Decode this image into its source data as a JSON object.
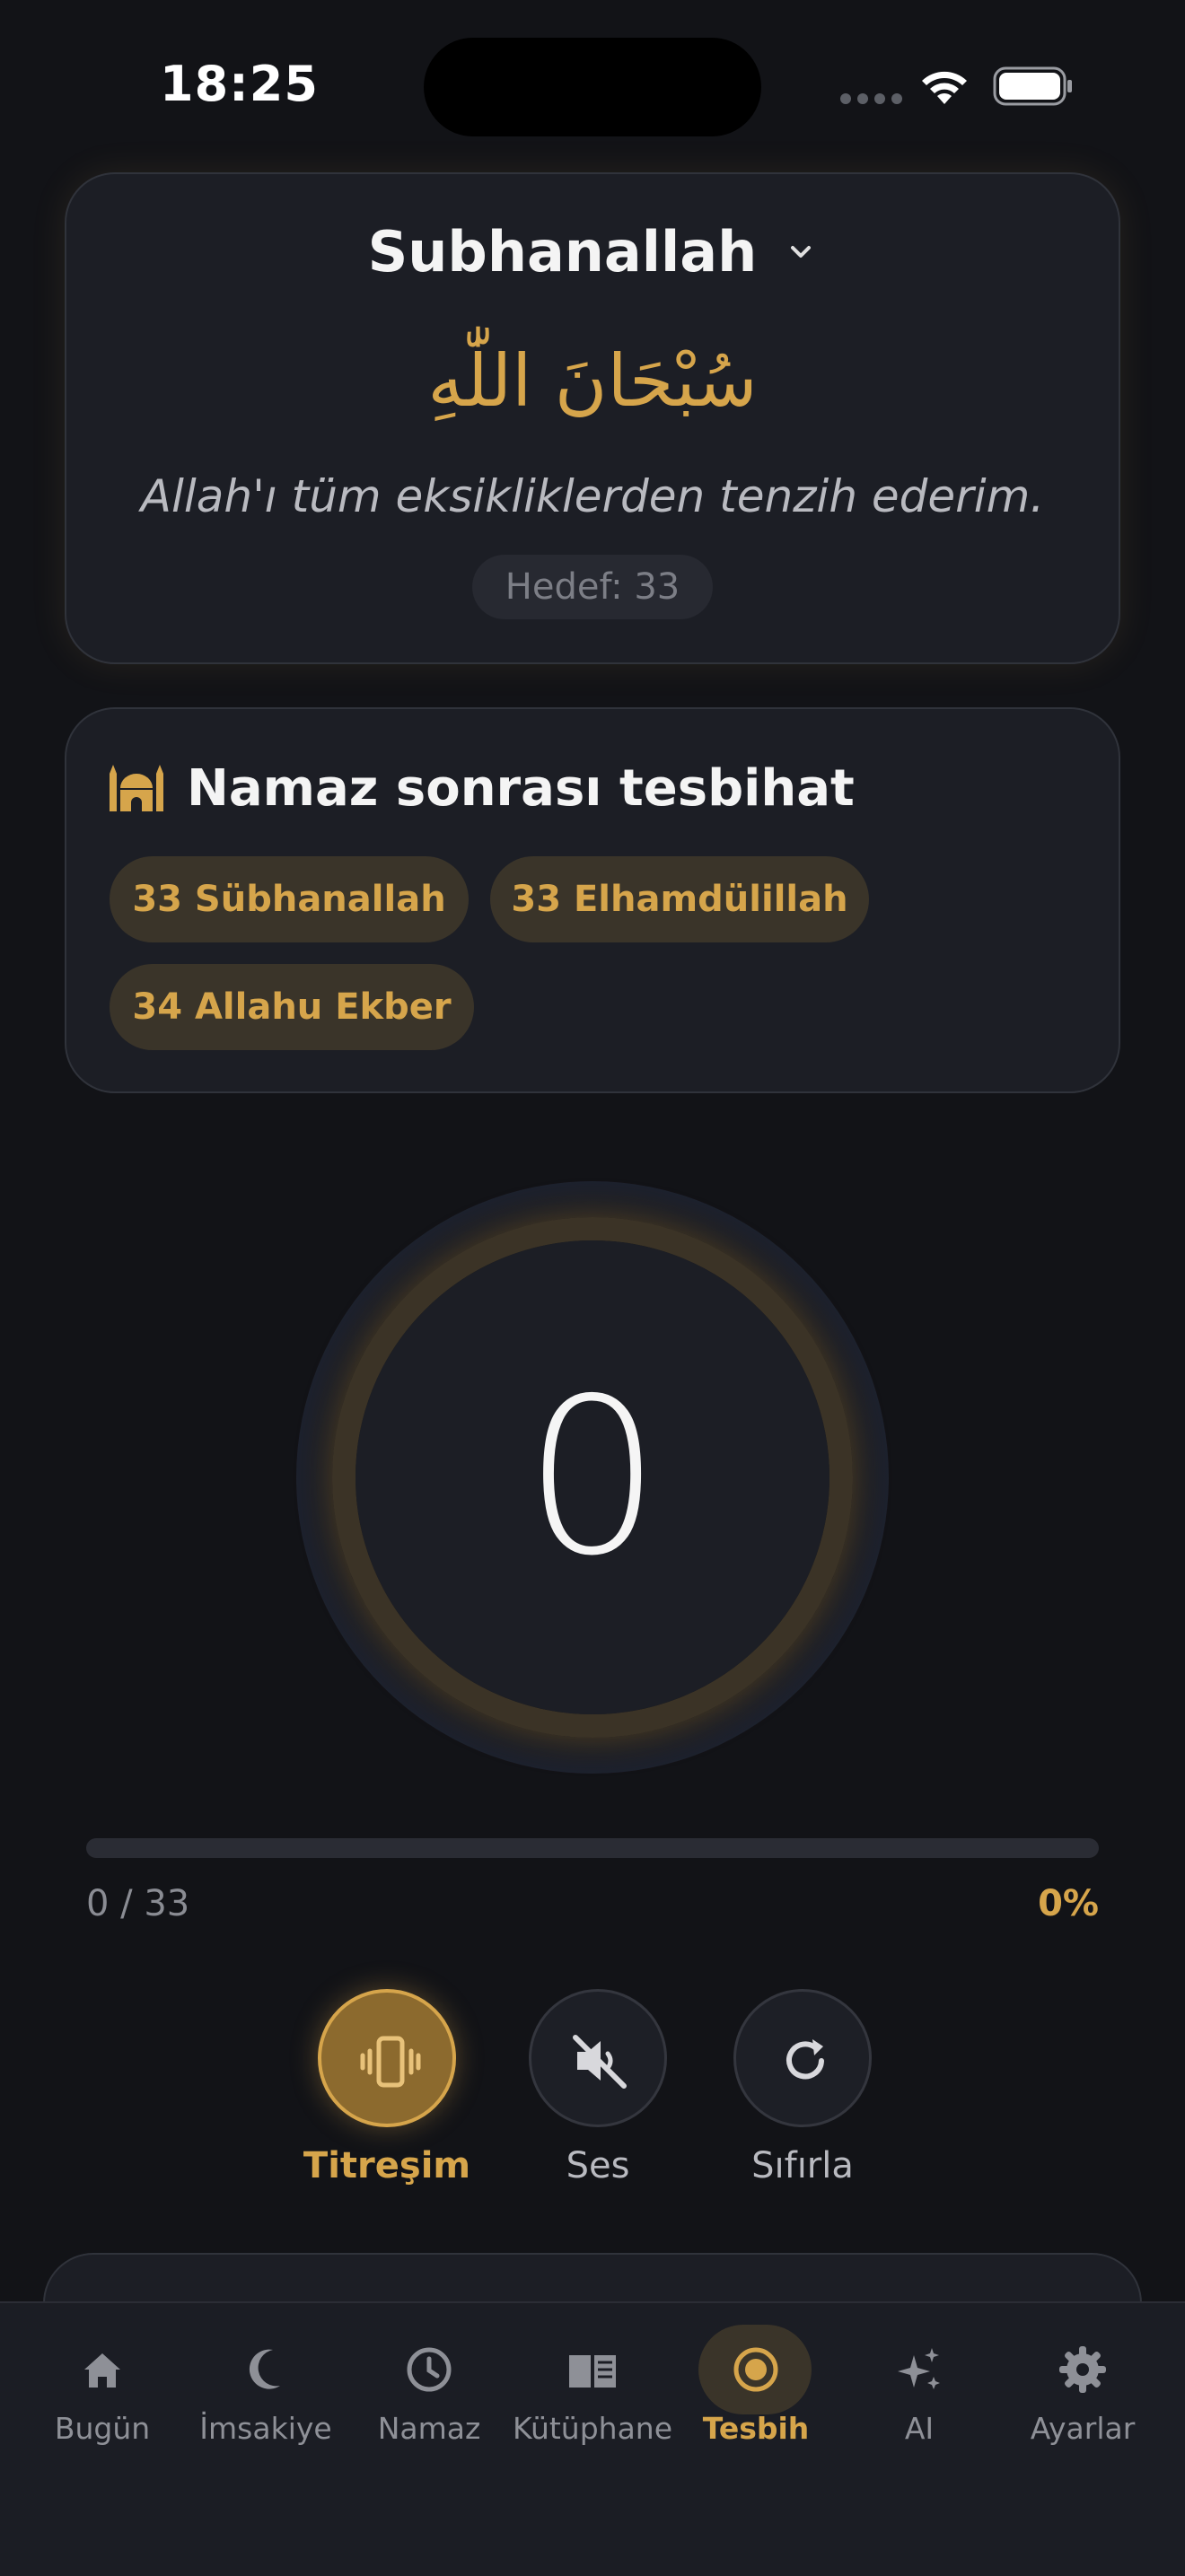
{
  "status_bar": {
    "time": "18:25"
  },
  "dhikr_card": {
    "title": "Subhanallah",
    "arabic": "سُبْحَانَ اللّٰهِ",
    "meaning": "Allah'ı tüm eksikliklerden tenzih ederim.",
    "goal_label": "Hedef: 33",
    "dropdown_icon": "chevron-down-icon"
  },
  "tesbihat_card": {
    "icon": "mosque-icon",
    "title": "Namaz sonrası tesbihat",
    "chips": [
      {
        "label": "33 Sübhanallah"
      },
      {
        "label": "33 Elhamdülillah"
      },
      {
        "label": "34 Allahu Ekber"
      }
    ]
  },
  "counter": {
    "value": "0"
  },
  "progress": {
    "count_label": "0 / 33",
    "percent_label": "0%",
    "fraction": 0
  },
  "controls": {
    "vibration": {
      "label": "Titreşim",
      "icon": "vibration-icon",
      "active": true
    },
    "sound": {
      "label": "Ses",
      "icon": "speaker-muted-icon",
      "active": false
    },
    "reset": {
      "label": "Sıfırla",
      "icon": "refresh-icon",
      "active": false
    }
  },
  "tab_bar": {
    "items": [
      {
        "label": "Bugün",
        "icon": "home-icon"
      },
      {
        "label": "İmsakiye",
        "icon": "crescent-moon-icon"
      },
      {
        "label": "Namaz",
        "icon": "clock-icon"
      },
      {
        "label": "Kütüphane",
        "icon": "book-icon"
      },
      {
        "label": "Tesbih",
        "icon": "tesbih-target-icon",
        "active": true
      },
      {
        "label": "AI",
        "icon": "sparkles-icon"
      },
      {
        "label": "Ayarlar",
        "icon": "gear-icon"
      }
    ]
  },
  "colors": {
    "background": "#121317",
    "card": "#1c1e25",
    "accent": "#d6a54b",
    "muted_text": "#8e9097"
  }
}
